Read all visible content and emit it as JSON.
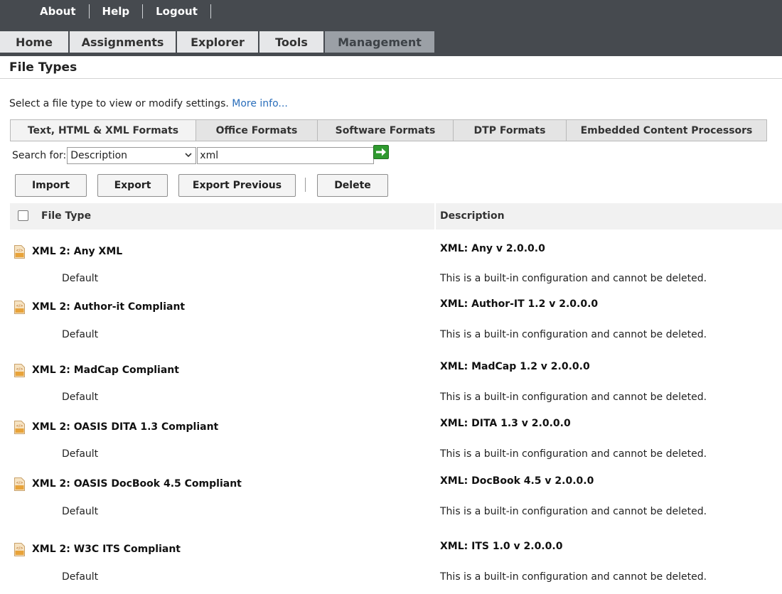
{
  "top_links": [
    "About",
    "Help",
    "Logout"
  ],
  "main_tabs": [
    {
      "label": "Home",
      "active": false
    },
    {
      "label": "Assignments",
      "active": false
    },
    {
      "label": "Explorer",
      "active": false
    },
    {
      "label": "Tools",
      "active": false
    },
    {
      "label": "Management",
      "active": true
    }
  ],
  "page": {
    "title": "File Types",
    "intro": "Select a file type to view or modify settings.",
    "more_info": "More info..."
  },
  "format_tabs": [
    {
      "label": "Text, HTML & XML Formats",
      "active": true
    },
    {
      "label": "Office Formats",
      "active": false
    },
    {
      "label": "Software Formats",
      "active": false
    },
    {
      "label": "DTP Formats",
      "active": false
    },
    {
      "label": "Embedded Content Processors",
      "active": false
    }
  ],
  "search": {
    "label": "Search for:",
    "field": "Description",
    "value": "xml"
  },
  "buttons": {
    "import": "Import",
    "export": "Export",
    "export_previous": "Export Previous",
    "delete": "Delete"
  },
  "table": {
    "headers": {
      "file_type": "File Type",
      "description": "Description"
    },
    "rows": [
      {
        "name": "XML 2: Any XML",
        "config": "Default",
        "description": "XML: Any v 2.0.0.0",
        "note": "This is a built-in configuration and cannot be deleted."
      },
      {
        "name": "XML 2: Author-it Compliant",
        "config": "Default",
        "description": "XML: Author-IT 1.2 v 2.0.0.0",
        "note": "This is a built-in configuration and cannot be deleted."
      },
      {
        "name": "XML 2: MadCap Compliant",
        "config": "Default",
        "description": "XML: MadCap 1.2 v 2.0.0.0",
        "note": "This is a built-in configuration and cannot be deleted."
      },
      {
        "name": "XML 2: OASIS DITA 1.3 Compliant",
        "config": "Default",
        "description": "XML: DITA 1.3 v 2.0.0.0",
        "note": "This is a built-in configuration and cannot be deleted."
      },
      {
        "name": "XML 2: OASIS DocBook 4.5 Compliant",
        "config": "Default",
        "description": "XML: DocBook 4.5 v 2.0.0.0",
        "note": "This is a built-in configuration and cannot be deleted."
      },
      {
        "name": "XML 2: W3C ITS Compliant",
        "config": "Default",
        "description": "XML: ITS 1.0 v 2.0.0.0",
        "note": "This is a built-in configuration and cannot be deleted."
      }
    ]
  },
  "icons": {
    "file_type": "xml-file-icon",
    "go": "arrow-right-icon",
    "select": "chevron-down-icon"
  },
  "colors": {
    "top_bar": "#464a4f",
    "active_tab": "#9ba0a6",
    "link": "#2a6ebb",
    "go_button": "#2f9a2f",
    "xml_icon": "#e8a33a"
  }
}
